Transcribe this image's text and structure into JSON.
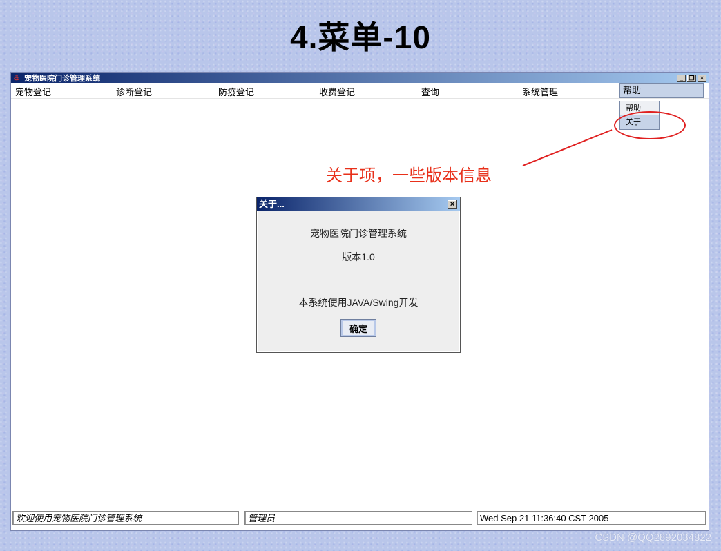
{
  "slide": {
    "title": "4.菜单-10"
  },
  "window": {
    "title": "宠物医院门诊管理系统"
  },
  "window_buttons": {
    "minimize": "_",
    "restore": "❐",
    "close": "×"
  },
  "menubar": {
    "items": [
      "宠物登记",
      "诊断登记",
      "防疫登记",
      "收费登记",
      "查询",
      "系统管理",
      "帮助"
    ]
  },
  "help_menu": {
    "items": [
      "帮助",
      "关于"
    ],
    "selected": "关于"
  },
  "annotation": {
    "text": "关于项，一些版本信息",
    "color": "#e8301a"
  },
  "about_dialog": {
    "title": "关于...",
    "close": "×",
    "app_name": "宠物医院门诊管理系统",
    "version": "版本1.0",
    "tech": "本系统使用JAVA/Swing开发",
    "ok_button": "确定"
  },
  "statusbar": {
    "welcome": "欢迎使用宠物医院门诊管理系统",
    "user": "管理员",
    "datetime": "Wed Sep 21 11:36:40 CST 2005"
  },
  "watermark": "CSDN @QQ2892034822",
  "colors": {
    "titlebar_start": "#0a246a",
    "titlebar_end": "#a6caf0",
    "highlight": "#e02020"
  }
}
